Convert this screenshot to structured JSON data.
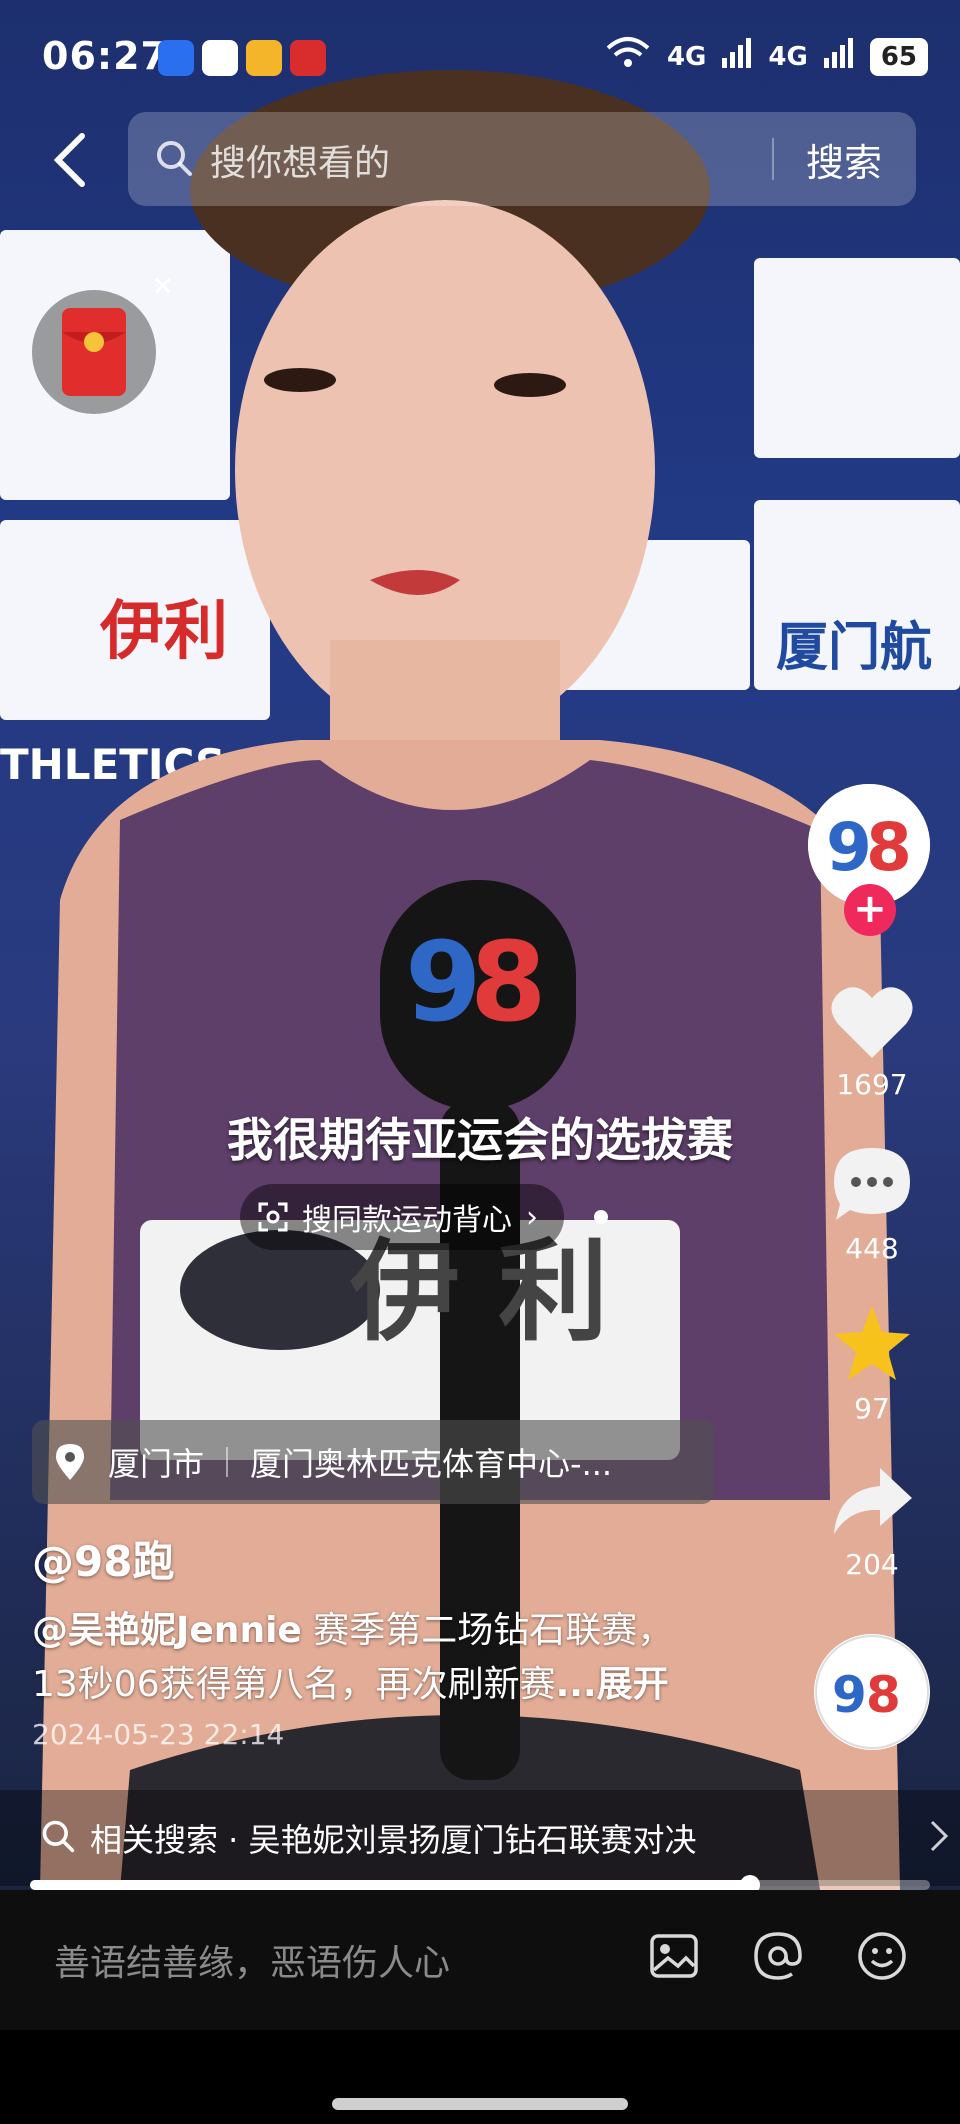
{
  "status_bar": {
    "time": "06:27",
    "network_1": "4G",
    "network_2": "4G",
    "wifi_badge": "6",
    "battery": "65"
  },
  "search": {
    "placeholder": "搜你想看的",
    "button": "搜索"
  },
  "video": {
    "subtitle": "我很期待亚运会的选拔赛",
    "product_chip": "搜同款运动背心",
    "sponsor_text": "伊利",
    "backdrop_brand": "伊利",
    "backdrop_text_2": "厦门航",
    "backdrop_text_3": "THLETICS"
  },
  "right_rail": {
    "likes": "1697",
    "comments": "448",
    "favorites": "97",
    "shares": "204"
  },
  "post": {
    "location_city": "厦门市",
    "location_venue": "厦门奥林匹克体育中心-...",
    "author": "@98跑",
    "mention": "@吴艳妮Jennie",
    "description_1": " 赛季第二场钻石联赛，",
    "description_2": "13秒06获得第八名，再次刷新赛",
    "expand_label": "...展开",
    "date": "2024-05-23 22:14"
  },
  "related_search": {
    "text": "相关搜索 · 吴艳妮刘景扬厦门钻石联赛对决"
  },
  "playback": {
    "progress": 0.8
  },
  "comment_bar": {
    "placeholder": "善语结善缘，恶语伤人心"
  },
  "colors": {
    "accent_red": "#f0295c",
    "favorite_yellow": "#f7c21b"
  }
}
